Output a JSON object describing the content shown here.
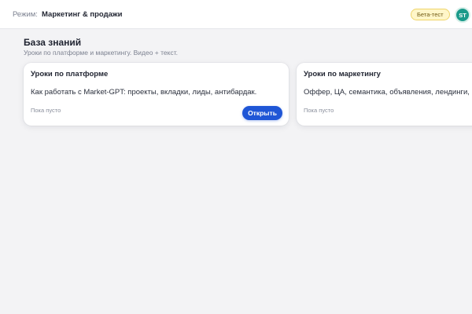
{
  "topbar": {
    "mode_label": "Режим:",
    "mode_value": "Маркетинг & продажи",
    "beta_badge": "Бета-тест",
    "avatar_initials": "ST"
  },
  "knowledge_base": {
    "title": "База знаний",
    "subtitle": "Уроки по платформе и маркетингу. Видео + текст.",
    "cards": [
      {
        "title": "Уроки по платформе",
        "description": "Как работать с Market-GPT: проекты, вкладки, лиды, антибардак.",
        "empty_text": "Пока пусто",
        "button_label": "Открыть"
      },
      {
        "title": "Уроки по маркетингу",
        "description": "Оффер, ЦА, семантика, объявления, лендинги,",
        "empty_text": "Пока пусто"
      }
    ]
  },
  "colors": {
    "accent": "#1f56d6",
    "background": "#f3f3f5",
    "badge_bg": "#fff6c9",
    "avatar_bg": "#1a9a8a"
  }
}
